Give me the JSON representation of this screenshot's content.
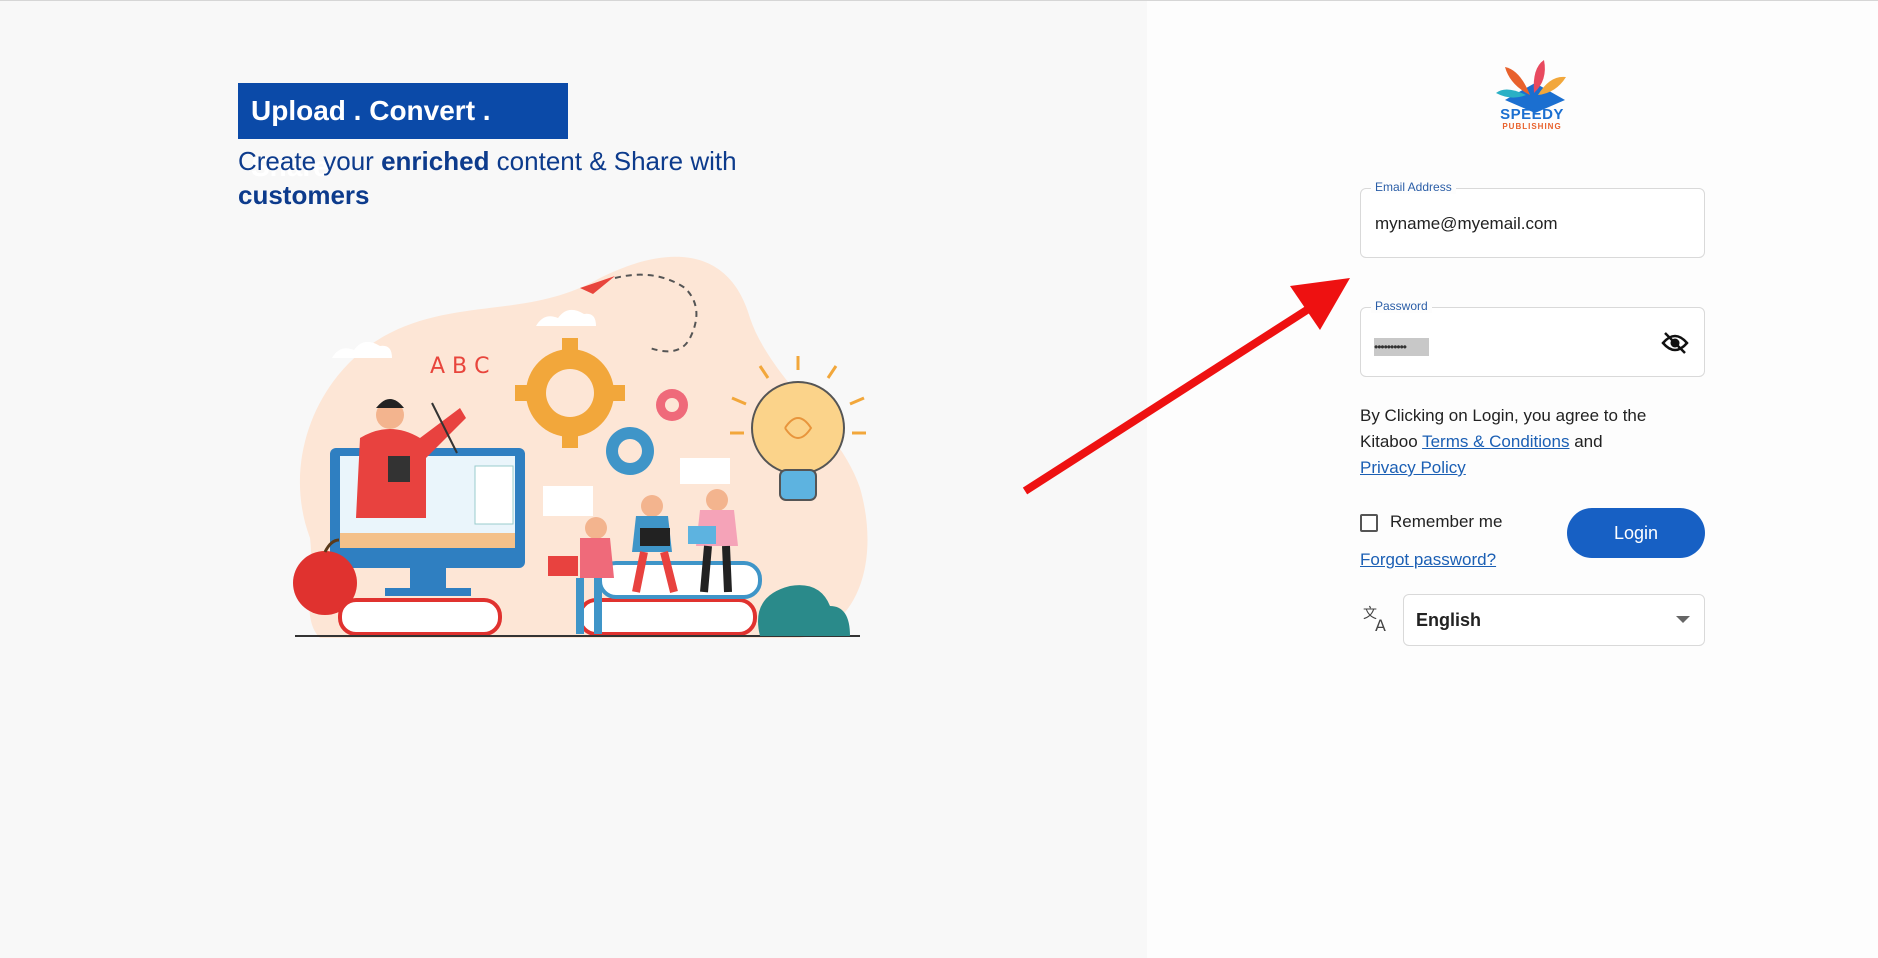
{
  "hero": {
    "banner": "Upload . Convert . Share",
    "tagline_part1": "Create your ",
    "tagline_bold1": "enriched",
    "tagline_part2": " content & Share with ",
    "tagline_bold2": "customers"
  },
  "illustration": {
    "letters": "A B C"
  },
  "brand": {
    "name": "SPEEDY",
    "sub": "PUBLISHING",
    "color_primary": "#1b6fd0",
    "color_secondary": "#e8612c"
  },
  "form": {
    "email_label": "Email Address",
    "email_value": "myname@myemail.com",
    "password_label": "Password",
    "password_mask": "••••••••••",
    "agree_text": "By Clicking on Login, you agree to the Kitaboo ",
    "terms_link": "Terms & Conditions",
    "and_text": " and",
    "privacy_link": "Privacy Policy",
    "remember_label": "Remember me",
    "forgot_link": "Forgot password?",
    "login_label": "Login",
    "language_value": "English"
  },
  "icons": {
    "eye": "eye-slash-icon",
    "language": "translate-icon",
    "dropdown": "caret-down-icon"
  },
  "colors": {
    "accent": "#1760c4",
    "banner": "#0b4aa8",
    "arrow": "#ee1111"
  }
}
